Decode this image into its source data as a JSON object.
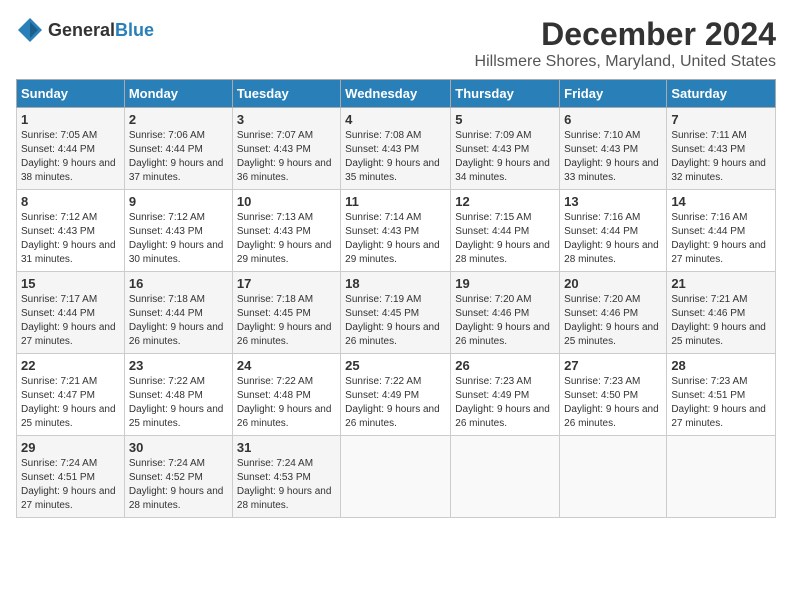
{
  "logo": {
    "general": "General",
    "blue": "Blue"
  },
  "title": "December 2024",
  "subtitle": "Hillsmere Shores, Maryland, United States",
  "headers": [
    "Sunday",
    "Monday",
    "Tuesday",
    "Wednesday",
    "Thursday",
    "Friday",
    "Saturday"
  ],
  "weeks": [
    [
      {
        "day": "1",
        "sunrise": "Sunrise: 7:05 AM",
        "sunset": "Sunset: 4:44 PM",
        "daylight": "Daylight: 9 hours and 38 minutes."
      },
      {
        "day": "2",
        "sunrise": "Sunrise: 7:06 AM",
        "sunset": "Sunset: 4:44 PM",
        "daylight": "Daylight: 9 hours and 37 minutes."
      },
      {
        "day": "3",
        "sunrise": "Sunrise: 7:07 AM",
        "sunset": "Sunset: 4:43 PM",
        "daylight": "Daylight: 9 hours and 36 minutes."
      },
      {
        "day": "4",
        "sunrise": "Sunrise: 7:08 AM",
        "sunset": "Sunset: 4:43 PM",
        "daylight": "Daylight: 9 hours and 35 minutes."
      },
      {
        "day": "5",
        "sunrise": "Sunrise: 7:09 AM",
        "sunset": "Sunset: 4:43 PM",
        "daylight": "Daylight: 9 hours and 34 minutes."
      },
      {
        "day": "6",
        "sunrise": "Sunrise: 7:10 AM",
        "sunset": "Sunset: 4:43 PM",
        "daylight": "Daylight: 9 hours and 33 minutes."
      },
      {
        "day": "7",
        "sunrise": "Sunrise: 7:11 AM",
        "sunset": "Sunset: 4:43 PM",
        "daylight": "Daylight: 9 hours and 32 minutes."
      }
    ],
    [
      {
        "day": "8",
        "sunrise": "Sunrise: 7:12 AM",
        "sunset": "Sunset: 4:43 PM",
        "daylight": "Daylight: 9 hours and 31 minutes."
      },
      {
        "day": "9",
        "sunrise": "Sunrise: 7:12 AM",
        "sunset": "Sunset: 4:43 PM",
        "daylight": "Daylight: 9 hours and 30 minutes."
      },
      {
        "day": "10",
        "sunrise": "Sunrise: 7:13 AM",
        "sunset": "Sunset: 4:43 PM",
        "daylight": "Daylight: 9 hours and 29 minutes."
      },
      {
        "day": "11",
        "sunrise": "Sunrise: 7:14 AM",
        "sunset": "Sunset: 4:43 PM",
        "daylight": "Daylight: 9 hours and 29 minutes."
      },
      {
        "day": "12",
        "sunrise": "Sunrise: 7:15 AM",
        "sunset": "Sunset: 4:44 PM",
        "daylight": "Daylight: 9 hours and 28 minutes."
      },
      {
        "day": "13",
        "sunrise": "Sunrise: 7:16 AM",
        "sunset": "Sunset: 4:44 PM",
        "daylight": "Daylight: 9 hours and 28 minutes."
      },
      {
        "day": "14",
        "sunrise": "Sunrise: 7:16 AM",
        "sunset": "Sunset: 4:44 PM",
        "daylight": "Daylight: 9 hours and 27 minutes."
      }
    ],
    [
      {
        "day": "15",
        "sunrise": "Sunrise: 7:17 AM",
        "sunset": "Sunset: 4:44 PM",
        "daylight": "Daylight: 9 hours and 27 minutes."
      },
      {
        "day": "16",
        "sunrise": "Sunrise: 7:18 AM",
        "sunset": "Sunset: 4:44 PM",
        "daylight": "Daylight: 9 hours and 26 minutes."
      },
      {
        "day": "17",
        "sunrise": "Sunrise: 7:18 AM",
        "sunset": "Sunset: 4:45 PM",
        "daylight": "Daylight: 9 hours and 26 minutes."
      },
      {
        "day": "18",
        "sunrise": "Sunrise: 7:19 AM",
        "sunset": "Sunset: 4:45 PM",
        "daylight": "Daylight: 9 hours and 26 minutes."
      },
      {
        "day": "19",
        "sunrise": "Sunrise: 7:20 AM",
        "sunset": "Sunset: 4:46 PM",
        "daylight": "Daylight: 9 hours and 26 minutes."
      },
      {
        "day": "20",
        "sunrise": "Sunrise: 7:20 AM",
        "sunset": "Sunset: 4:46 PM",
        "daylight": "Daylight: 9 hours and 25 minutes."
      },
      {
        "day": "21",
        "sunrise": "Sunrise: 7:21 AM",
        "sunset": "Sunset: 4:46 PM",
        "daylight": "Daylight: 9 hours and 25 minutes."
      }
    ],
    [
      {
        "day": "22",
        "sunrise": "Sunrise: 7:21 AM",
        "sunset": "Sunset: 4:47 PM",
        "daylight": "Daylight: 9 hours and 25 minutes."
      },
      {
        "day": "23",
        "sunrise": "Sunrise: 7:22 AM",
        "sunset": "Sunset: 4:48 PM",
        "daylight": "Daylight: 9 hours and 25 minutes."
      },
      {
        "day": "24",
        "sunrise": "Sunrise: 7:22 AM",
        "sunset": "Sunset: 4:48 PM",
        "daylight": "Daylight: 9 hours and 26 minutes."
      },
      {
        "day": "25",
        "sunrise": "Sunrise: 7:22 AM",
        "sunset": "Sunset: 4:49 PM",
        "daylight": "Daylight: 9 hours and 26 minutes."
      },
      {
        "day": "26",
        "sunrise": "Sunrise: 7:23 AM",
        "sunset": "Sunset: 4:49 PM",
        "daylight": "Daylight: 9 hours and 26 minutes."
      },
      {
        "day": "27",
        "sunrise": "Sunrise: 7:23 AM",
        "sunset": "Sunset: 4:50 PM",
        "daylight": "Daylight: 9 hours and 26 minutes."
      },
      {
        "day": "28",
        "sunrise": "Sunrise: 7:23 AM",
        "sunset": "Sunset: 4:51 PM",
        "daylight": "Daylight: 9 hours and 27 minutes."
      }
    ],
    [
      {
        "day": "29",
        "sunrise": "Sunrise: 7:24 AM",
        "sunset": "Sunset: 4:51 PM",
        "daylight": "Daylight: 9 hours and 27 minutes."
      },
      {
        "day": "30",
        "sunrise": "Sunrise: 7:24 AM",
        "sunset": "Sunset: 4:52 PM",
        "daylight": "Daylight: 9 hours and 28 minutes."
      },
      {
        "day": "31",
        "sunrise": "Sunrise: 7:24 AM",
        "sunset": "Sunset: 4:53 PM",
        "daylight": "Daylight: 9 hours and 28 minutes."
      },
      null,
      null,
      null,
      null
    ]
  ]
}
